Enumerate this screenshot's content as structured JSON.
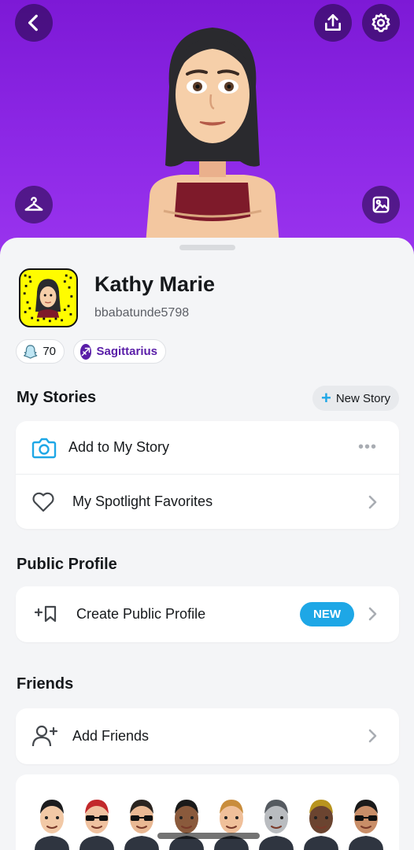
{
  "profile": {
    "name": "Kathy Marie",
    "username": "bbabatunde5798",
    "snap_score": "70",
    "zodiac": "Sagittarius"
  },
  "stories": {
    "title": "My Stories",
    "new_story_label": "New Story",
    "add_label": "Add to My Story",
    "spotlight_label": "My Spotlight Favorites"
  },
  "public_profile": {
    "title": "Public Profile",
    "create_label": "Create Public Profile",
    "badge": "NEW"
  },
  "friends": {
    "title": "Friends",
    "add_label": "Add Friends",
    "avatars_shown": 8
  },
  "colors": {
    "hero": "#8d28e6",
    "accent_blue": "#1ea7e6",
    "snapcode_yellow": "#fffc00",
    "zodiac_purple": "#5a1ea8"
  },
  "icons": {
    "back": "chevron-left-icon",
    "share": "share-icon",
    "settings": "gear-icon",
    "outfit": "hanger-icon",
    "gallery": "photo-icon",
    "story": "camera-icon",
    "spotlight": "heart-icon",
    "public_profile": "bookmark-plus-icon",
    "friends": "add-person-icon"
  }
}
